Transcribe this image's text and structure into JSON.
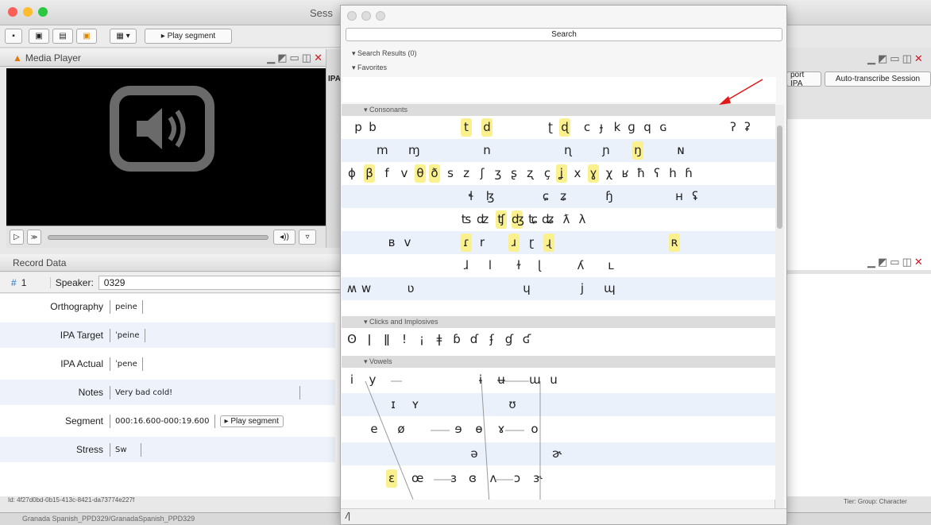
{
  "main_window": {
    "title": "Sess"
  },
  "toolbar": {
    "play_segment": "▸ Play segment"
  },
  "media_player": {
    "title": "Media Player",
    "volume": "◂))"
  },
  "background": {
    "ipa_tab": "IPA",
    "port_ipa": "port IPA",
    "auto_transcribe": "Auto-transcribe Session",
    "tier_label": "Tier: Group: Character"
  },
  "record_data": {
    "title": "Record Data",
    "record_no": "1",
    "speaker_label": "Speaker:",
    "speaker": "0329",
    "fields": [
      {
        "label": "Orthography",
        "value": "peine"
      },
      {
        "label": "IPA Target",
        "value": "ˈpeine"
      },
      {
        "label": "IPA Actual",
        "value": "ˈpene"
      },
      {
        "label": "Notes",
        "value": "Very bad cold!"
      },
      {
        "label": "Segment",
        "value": "000:16.600-000:19.600"
      },
      {
        "label": "Stress",
        "value": "Sw"
      }
    ],
    "play_segment": "▸ Play segment",
    "record_id": "Id: 4f27d0bd-0b15-413c-8421-da73774e227f"
  },
  "status_bar": {
    "text": "Granada Spanish_PPD329/GranadaSpanish_PPD329"
  },
  "ipa_window": {
    "search_button": "Search",
    "search_results": "Search Results (0)",
    "favorites": "Favorites",
    "consonants": "Consonants",
    "clicks": "Clicks and Implosives",
    "vowels": "Vowels",
    "bottom_input": "/|",
    "accent": "#faf08e"
  },
  "consonant_rows": [
    [
      [
        "p",
        0
      ],
      [
        "b",
        0
      ],
      [
        "t",
        1
      ],
      [
        "d",
        1
      ],
      [
        "ʈ",
        0
      ],
      [
        "ɖ",
        1
      ],
      [
        "c",
        0
      ],
      [
        "ɟ",
        0
      ],
      [
        "k",
        0
      ],
      [
        "ɡ",
        0
      ],
      [
        "q",
        0
      ],
      [
        "ɢ",
        0
      ],
      [
        "ʔ",
        0
      ],
      [
        "ʡ",
        0
      ]
    ],
    [
      [
        "m",
        0
      ],
      [
        "ɱ",
        0
      ],
      [
        "n",
        0
      ],
      [
        "ɳ",
        0
      ],
      [
        "ɲ",
        0
      ],
      [
        "ŋ",
        1
      ],
      [
        "ɴ",
        0
      ]
    ],
    [
      [
        "ɸ",
        0
      ],
      [
        "β",
        1
      ],
      [
        "f",
        0
      ],
      [
        "v",
        0
      ],
      [
        "θ",
        1
      ],
      [
        "ð",
        1
      ],
      [
        "s",
        0
      ],
      [
        "z",
        0
      ],
      [
        "ʃ",
        0
      ],
      [
        "ʒ",
        0
      ],
      [
        "ʂ",
        0
      ],
      [
        "ʐ",
        0
      ],
      [
        "ç",
        0
      ],
      [
        "ʝ",
        1
      ],
      [
        "x",
        0
      ],
      [
        "ɣ",
        1
      ],
      [
        "χ",
        0
      ],
      [
        "ʁ",
        0
      ],
      [
        "ħ",
        0
      ],
      [
        "ʕ",
        0
      ],
      [
        "h",
        0
      ],
      [
        "ɦ",
        0
      ]
    ],
    [
      [
        "ɬ",
        0
      ],
      [
        "ɮ",
        0
      ],
      [
        "ɕ",
        0
      ],
      [
        "ʑ",
        0
      ],
      [
        "ɧ",
        0
      ],
      [
        "ʜ",
        0
      ],
      [
        "ʢ",
        0
      ]
    ],
    [
      [
        "ʦ",
        0
      ],
      [
        "ʣ",
        0
      ],
      [
        "ʧ",
        1
      ],
      [
        "ʤ",
        1
      ],
      [
        "ʨ",
        0
      ],
      [
        "ʥ",
        0
      ],
      [
        "ƛ",
        0
      ],
      [
        "λ",
        0
      ]
    ],
    [
      [
        "ʙ",
        0
      ],
      [
        "ⅴ",
        0
      ],
      [
        "ɾ",
        1
      ],
      [
        "r",
        0
      ],
      [
        "ɹ",
        1
      ],
      [
        "ɽ",
        0
      ],
      [
        "ɻ",
        1
      ],
      [
        "ʀ",
        1
      ]
    ],
    [
      [
        "ɺ",
        0
      ],
      [
        "l",
        0
      ],
      [
        "ɫ",
        0
      ],
      [
        "ɭ",
        0
      ],
      [
        "ʎ",
        0
      ],
      [
        "ʟ",
        0
      ]
    ],
    [
      [
        "ʍ",
        0
      ],
      [
        "w",
        0
      ],
      [
        "ʋ",
        0
      ],
      [
        "ɥ",
        0
      ],
      [
        "j",
        0
      ],
      [
        "ɰ",
        0
      ]
    ]
  ],
  "click_row": [
    "ʘ",
    "ǀ",
    "ǁ",
    "!",
    "¡",
    "ǂ",
    "ɓ",
    "ɗ",
    "ʄ",
    "ɠ",
    "ʛ"
  ],
  "vowel_rows": [
    [
      [
        "i",
        0
      ],
      [
        "y",
        0
      ],
      [
        "ɨ",
        0
      ],
      [
        "ʉ",
        0
      ],
      [
        "ɯ",
        0
      ],
      [
        "u",
        0
      ]
    ],
    [
      [
        "ɪ",
        0
      ],
      [
        "ʏ",
        0
      ],
      [
        "ʊ",
        0
      ]
    ],
    [
      [
        "e",
        0
      ],
      [
        "ø",
        0
      ],
      [
        "ɘ",
        0
      ],
      [
        "ɵ",
        0
      ],
      [
        "ɤ",
        0
      ],
      [
        "o",
        0
      ]
    ],
    [
      [
        "ə",
        0
      ],
      [
        "ɚ",
        0
      ]
    ],
    [
      [
        "ɛ",
        1
      ],
      [
        "œ",
        0
      ],
      [
        "ɜ",
        0
      ],
      [
        "ɞ",
        0
      ],
      [
        "ʌ",
        0
      ],
      [
        "ɔ",
        0
      ],
      [
        "ɝ",
        0
      ]
    ]
  ]
}
